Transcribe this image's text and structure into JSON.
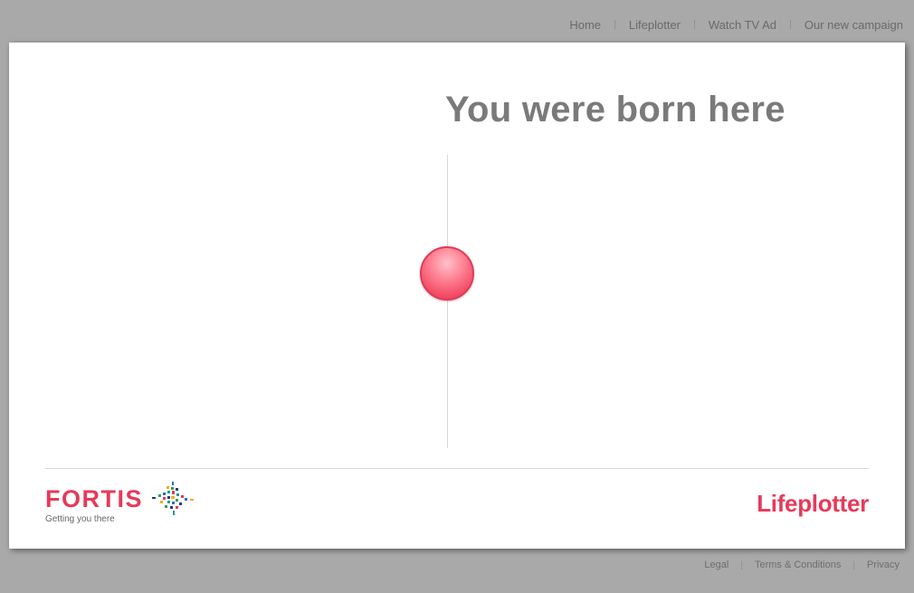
{
  "top_nav": {
    "items": [
      {
        "label": "Home"
      },
      {
        "label": "Lifeplotter"
      },
      {
        "label": "Watch TV Ad"
      },
      {
        "label": "Our new campaign"
      }
    ],
    "separator": "|"
  },
  "main": {
    "headline": "You were born here"
  },
  "brand": {
    "name": "FORTIS",
    "tagline": "Getting you there",
    "mark_icon": "fortis-mosaic-star-icon"
  },
  "product": {
    "logo_text": "Lifeplotter"
  },
  "footer_nav": {
    "items": [
      {
        "label": "Legal"
      },
      {
        "label": "Terms & Conditions"
      },
      {
        "label": "Privacy"
      }
    ],
    "separator": "|"
  },
  "colors": {
    "page_background": "#a9a9a9",
    "panel_background": "#ffffff",
    "accent": "#e63a5a",
    "headline": "#7a7a7a",
    "nav_text": "#6a6a6a"
  }
}
